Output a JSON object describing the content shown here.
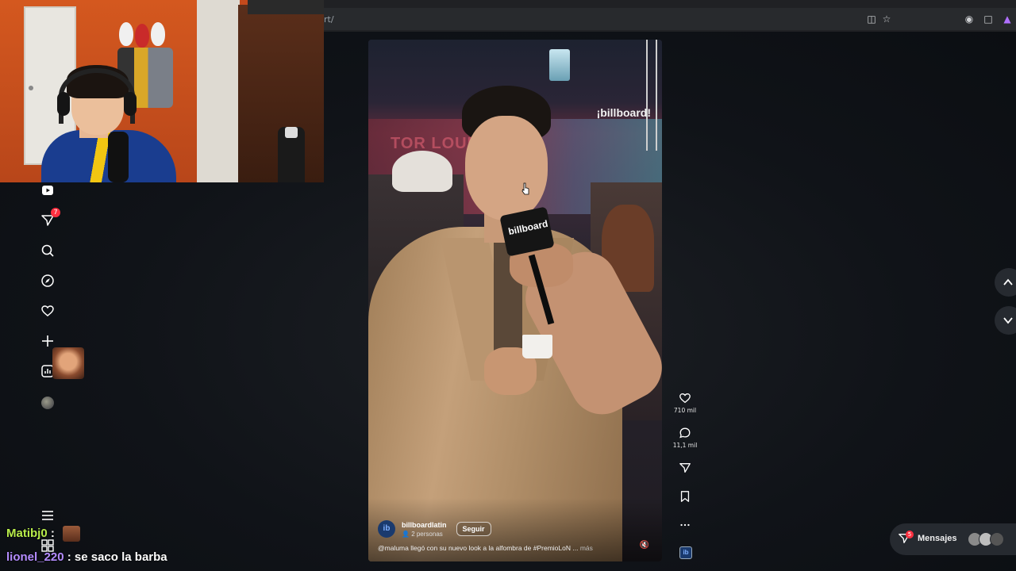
{
  "browser": {
    "url": "rt/"
  },
  "leftnav": {
    "notification_count": "7"
  },
  "video": {
    "watermark": "¡billboard!",
    "mic_label": "billboard",
    "background_sign": "TOR LOUN",
    "account": {
      "avatar_label": "ib",
      "name": "billboardlatin",
      "followers": "2 personas",
      "follow_label": "Seguir"
    },
    "caption": "@maluma llegó con su nuevo look a la alfombra de #PremioLoN ...",
    "caption_more": "más"
  },
  "actions": {
    "likes": "710 mil",
    "comments": "11,1 mil",
    "account_icon_label": "ib"
  },
  "messages": {
    "label": "Mensajes",
    "badge": "5"
  },
  "chat": [
    {
      "user": "Matibj0",
      "separator": ":",
      "message": ""
    },
    {
      "user": "lionel_220",
      "separator": ":",
      "message": "se saco la barba"
    }
  ]
}
